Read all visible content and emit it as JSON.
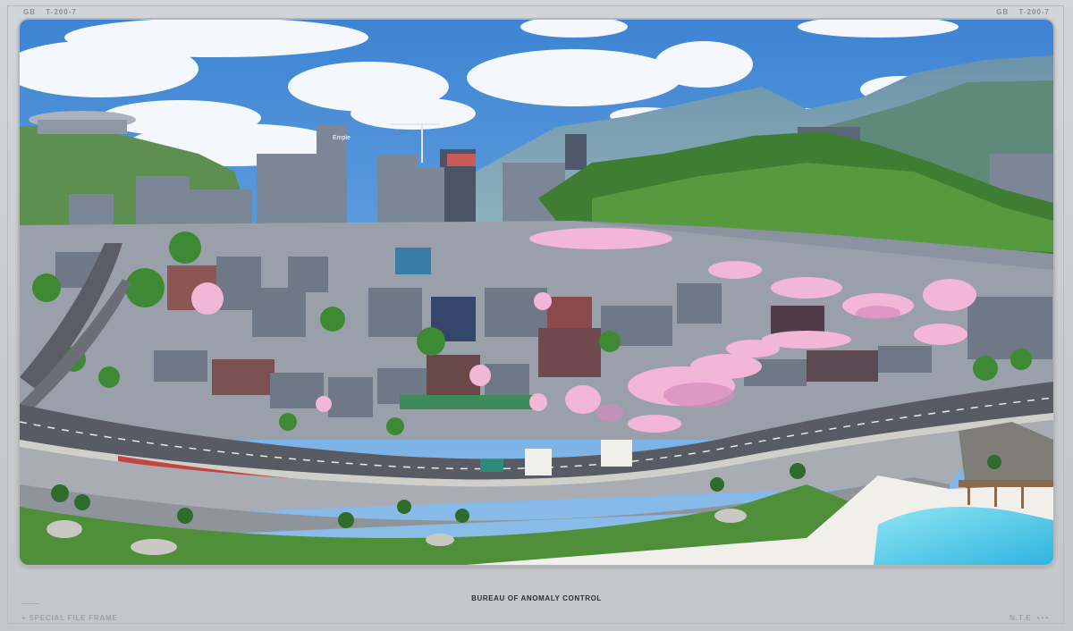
{
  "frame": {
    "top_left_tag": {
      "code": "GB",
      "serial": "T-200-7"
    },
    "top_right_tag": {
      "code": "GB",
      "serial": "T-200-7"
    },
    "caption": "BUREAU OF ANOMALY CONTROL",
    "footer_left": "+ SPECIAL FILE FRAME",
    "footer_right": "N.T.E",
    "footer_right_dots": "•••"
  },
  "scene": {
    "sign_text": "Emple"
  },
  "colors": {
    "frame_bg": "#cbcdd0",
    "sky": "#4a8fd6",
    "cherry_blossom": "#f2b6d6",
    "sea": "#5fd0e8",
    "grass": "#4f8f3a",
    "road": "#5a5d66"
  }
}
